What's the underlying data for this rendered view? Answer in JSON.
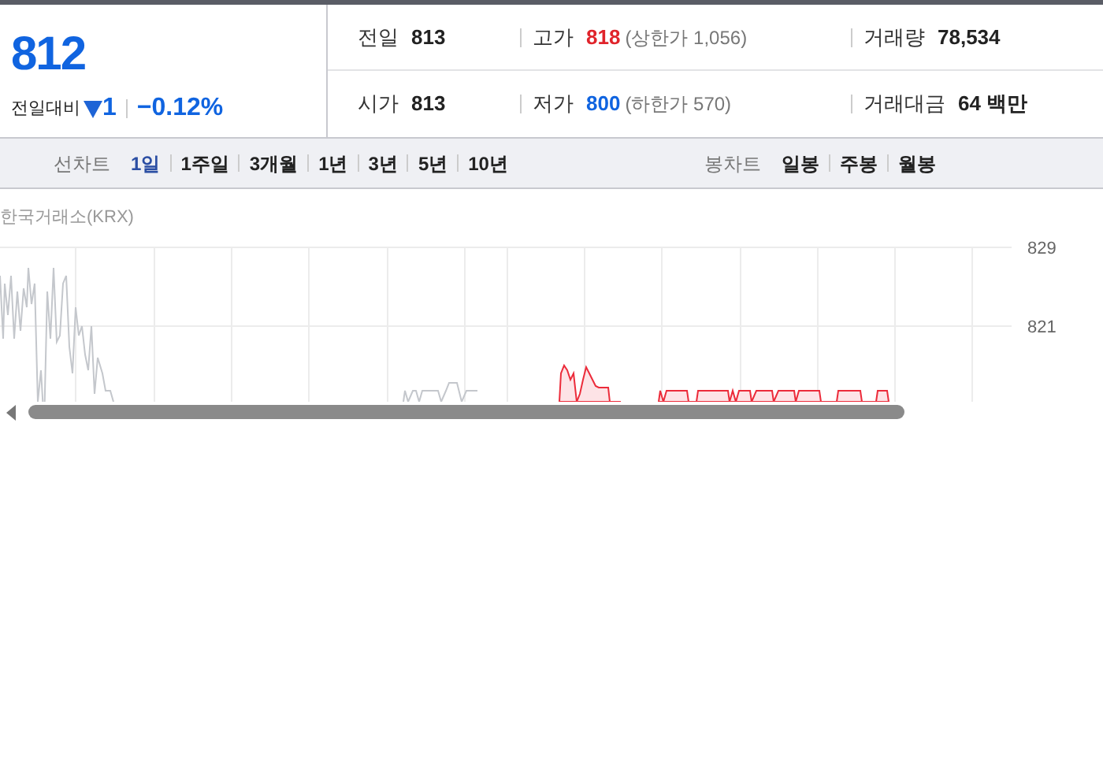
{
  "quote": {
    "price": "812",
    "change_label": "전일대비",
    "color": "#1064e0",
    "change": "1",
    "change_rate": "−0.12%"
  },
  "stats": [
    {
      "label": "전일",
      "value": "813",
      "color": "#222222"
    },
    {
      "label": "고가",
      "value": "818",
      "color": "#e0242b",
      "note": "(상한가 1,056)"
    },
    {
      "label": "거래량",
      "value": "78,534",
      "color": "#222222"
    },
    {
      "label": "시가",
      "value": "813",
      "color": "#222222"
    },
    {
      "label": "저가",
      "value": "800",
      "color": "#1064e0",
      "note": "(하한가 570)"
    },
    {
      "label": "거래대금",
      "value": "64 백만",
      "color": "#222222"
    }
  ],
  "line_chart_tabs": {
    "label": "선차트",
    "items": [
      {
        "label": "1일",
        "selected": true
      },
      {
        "label": "1주일",
        "selected": false
      },
      {
        "label": "3개월",
        "selected": false
      },
      {
        "label": "1년",
        "selected": false
      },
      {
        "label": "3년",
        "selected": false
      },
      {
        "label": "5년",
        "selected": false
      },
      {
        "label": "10년",
        "selected": false
      }
    ]
  },
  "candle_chart_tabs": {
    "label": "봉차트",
    "items": [
      {
        "label": "일봉",
        "selected": false
      },
      {
        "label": "주봉",
        "selected": false
      },
      {
        "label": "월봉",
        "selected": false
      }
    ]
  },
  "chart": {
    "source": "한국거래소(KRX)",
    "y_labels": [
      "829",
      "821"
    ]
  }
}
